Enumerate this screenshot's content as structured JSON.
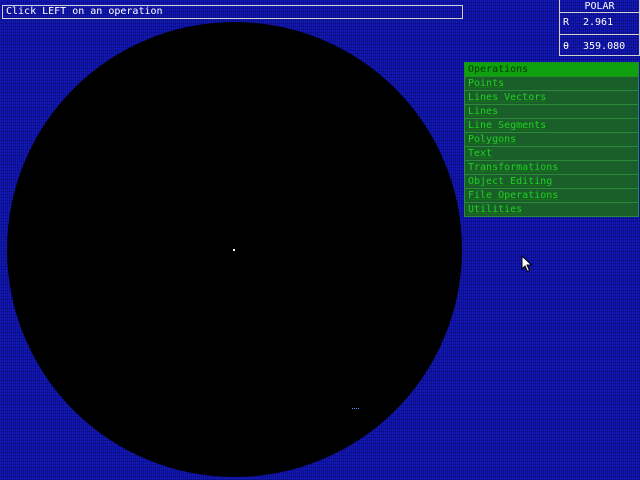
{
  "prompt": {
    "text": "Click LEFT on an operation"
  },
  "polar": {
    "title": "POLAR",
    "r_label": "R",
    "r_value": "2.961",
    "theta_label": "θ",
    "theta_value": "359.080"
  },
  "menu": {
    "header": "Operations",
    "items": [
      "Points",
      "Lines Vectors",
      "Lines",
      "Line Segments",
      "Polygons",
      "Text",
      "Transformations",
      "Object Editing",
      "File Operations",
      "Utilities"
    ]
  },
  "colors": {
    "background": "#0a0fa8",
    "display": "#000000",
    "menu_header": "#0fa10f",
    "menu_item_bg": "#1a5e2a",
    "menu_item_text": "#1ed41e"
  },
  "icons": {
    "cursor": "arrow-cursor-icon"
  }
}
